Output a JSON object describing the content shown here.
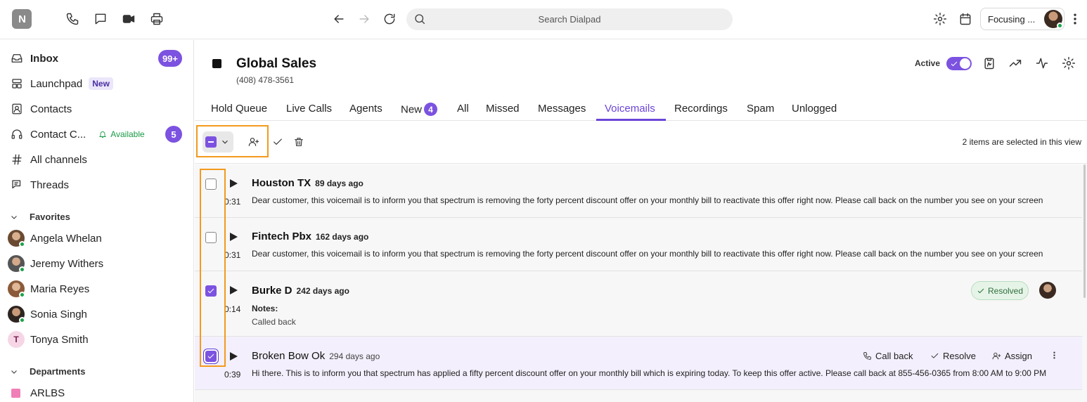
{
  "topbar": {
    "logo_text": "N",
    "search_placeholder": "Search Dialpad",
    "status_label": "Focusing ...",
    "icons": [
      "phone-icon",
      "message-icon",
      "video-icon",
      "printer-icon",
      "back-arrow-icon",
      "forward-arrow-icon",
      "refresh-icon",
      "search-icon",
      "gear-icon",
      "calendar-icon",
      "more-vertical-icon"
    ]
  },
  "sidebar": {
    "inbox": {
      "label": "Inbox",
      "badge": "99+"
    },
    "launchpad": {
      "label": "Launchpad",
      "tag": "New"
    },
    "contacts": {
      "label": "Contacts"
    },
    "contact_center": {
      "label": "Contact C...",
      "status": "Available",
      "badge": "5"
    },
    "all_channels": {
      "label": "All channels"
    },
    "threads": {
      "label": "Threads"
    },
    "favorites_header": "Favorites",
    "favorites": [
      {
        "name": "Angela Whelan"
      },
      {
        "name": "Jeremy Withers"
      },
      {
        "name": "Maria Reyes"
      },
      {
        "name": "Sonia Singh"
      },
      {
        "name": "Tonya Smith",
        "initial": "T"
      }
    ],
    "departments_header": "Departments",
    "departments": [
      {
        "name": "ARLBS",
        "color": "#f07fb8"
      }
    ]
  },
  "header": {
    "team_name": "Global Sales",
    "phone": "(408) 478-3561",
    "active_label": "Active"
  },
  "tabs": [
    {
      "label": "Hold Queue"
    },
    {
      "label": "Live Calls"
    },
    {
      "label": "Agents"
    },
    {
      "label": "New",
      "count": "4"
    },
    {
      "label": "All"
    },
    {
      "label": "Missed"
    },
    {
      "label": "Messages"
    },
    {
      "label": "Voicemails",
      "active": true
    },
    {
      "label": "Recordings"
    },
    {
      "label": "Spam"
    },
    {
      "label": "Unlogged"
    }
  ],
  "toolbar": {
    "selection_status": "2 items are selected in this view"
  },
  "voicemails": [
    {
      "caller": "Houston TX",
      "ago": "89 days ago",
      "duration": "0:31",
      "checked": false,
      "transcript": "Dear customer, this voicemail is to inform you that spectrum is removing the forty percent discount offer on your monthly bill to reactivate this offer right now. Please call back on the number you see on your screen"
    },
    {
      "caller": "Fintech Pbx",
      "ago": "162 days ago",
      "duration": "0:31",
      "checked": false,
      "transcript": "Dear customer, this voicemail is to inform you that spectrum is removing the forty percent discount offer on your monthly bill to reactivate this offer right now. Please call back on the number you see on your screen"
    },
    {
      "caller": "Burke D",
      "ago": "242 days ago",
      "duration": "0:14",
      "checked": true,
      "notes_label": "Notes:",
      "notes": "Called back",
      "status": "Resolved"
    },
    {
      "caller": "Broken Bow Ok",
      "ago": "294 days ago",
      "duration": "0:39",
      "checked": true,
      "transcript": "Hi there. This is to inform you that spectrum has applied a fifty percent discount offer on your monthly bill which is expiring today. To keep this offer active. Please call back at 855-456-0365 from 8:00 AM to 9:00 PM",
      "actions": {
        "call_back": "Call back",
        "resolve": "Resolve",
        "assign": "Assign"
      }
    }
  ],
  "colors": {
    "accent": "#7c52e0",
    "highlight": "#f39a1e",
    "available": "#1a9a46"
  }
}
